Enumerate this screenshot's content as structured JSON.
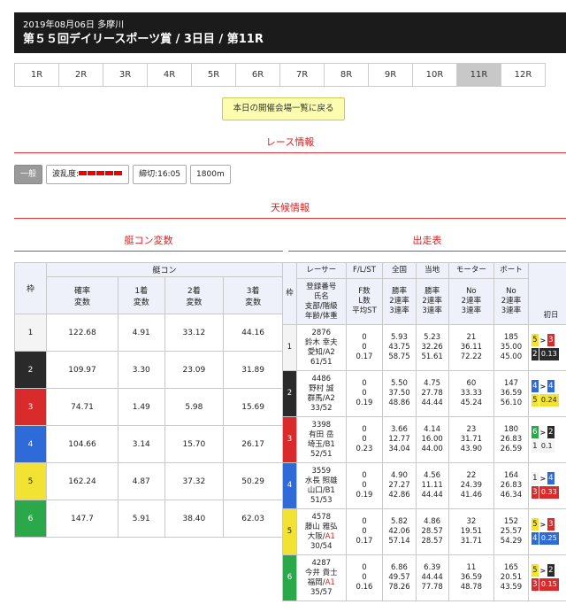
{
  "header": {
    "date": "2019年08月06日 多摩川",
    "title": "第５５回デイリースポーツ賞 / 3日目 / 第11R"
  },
  "race_tabs": [
    "1R",
    "2R",
    "3R",
    "4R",
    "5R",
    "6R",
    "7R",
    "8R",
    "9R",
    "10R",
    "11R",
    "12R"
  ],
  "active_race": "11R",
  "back_button": "本日の開催会場一覧に戻る",
  "sections": {
    "race_info": "レース情報",
    "weather": "天候情報",
    "kyotei_con": "艇コン変数",
    "entry": "出走表"
  },
  "race_info": {
    "grade": "一般",
    "wave_label": "波乱度:",
    "wave_level": 5,
    "deadline": "締切:16:05",
    "distance": "1800m"
  },
  "kyotei_table": {
    "group_header": "艇コン",
    "waku_header": "枠",
    "columns": [
      "確率\n変数",
      "1着\n変数",
      "2着\n変数",
      "3着\n変数"
    ],
    "rows": [
      {
        "waku": "1",
        "vals": [
          "122.68",
          "4.91",
          "33.12",
          "44.16"
        ]
      },
      {
        "waku": "2",
        "vals": [
          "109.97",
          "3.30",
          "23.09",
          "31.89"
        ]
      },
      {
        "waku": "3",
        "vals": [
          "74.71",
          "1.49",
          "5.98",
          "15.69"
        ]
      },
      {
        "waku": "4",
        "vals": [
          "104.66",
          "3.14",
          "15.70",
          "26.17"
        ]
      },
      {
        "waku": "5",
        "vals": [
          "162.24",
          "4.87",
          "37.32",
          "50.29"
        ]
      },
      {
        "waku": "6",
        "vals": [
          "147.7",
          "5.91",
          "38.40",
          "62.03"
        ]
      }
    ]
  },
  "entry_table": {
    "waku_header": "枠",
    "group_headers": [
      "レーサー",
      "F/L/ST",
      "全国",
      "当地",
      "モーター",
      "ボート"
    ],
    "sub_headers": [
      "登録番号\n氏名\n支部/階級\n年齢/体重",
      "F数\nL数\n平均ST",
      "勝率\n2連率\n3連率",
      "勝率\n2連率\n3連率",
      "No\n2連率\n3連率",
      "No\n2連率\n3連率"
    ],
    "recent_header": "初日",
    "rows": [
      {
        "waku": "1",
        "reg": "2876",
        "name": "鈴木 幸夫",
        "branch": "愛知/",
        "rank": "A2",
        "age": "61/51",
        "fl": [
          "0",
          "0",
          "0.17"
        ],
        "zenkoku": [
          "5.93",
          "43.75",
          "58.75"
        ],
        "touchi": [
          "5.23",
          "32.26",
          "51.61"
        ],
        "motor": [
          "21",
          "36.11",
          "72.22"
        ],
        "boat": [
          "185",
          "35.00",
          "45.00"
        ],
        "recent": {
          "top": [
            "5",
            "3"
          ],
          "bottom": [
            "2",
            "0.13"
          ]
        }
      },
      {
        "waku": "2",
        "reg": "4486",
        "name": "野村 誠",
        "branch": "群馬/",
        "rank": "A2",
        "age": "33/52",
        "fl": [
          "0",
          "0",
          "0.19"
        ],
        "zenkoku": [
          "5.50",
          "37.50",
          "48.86"
        ],
        "touchi": [
          "4.75",
          "27.78",
          "44.44"
        ],
        "motor": [
          "60",
          "33.33",
          "45.24"
        ],
        "boat": [
          "147",
          "36.59",
          "56.10"
        ],
        "recent": {
          "top": [
            "4",
            "4"
          ],
          "bottom": [
            "5",
            "0.24"
          ]
        }
      },
      {
        "waku": "3",
        "reg": "3398",
        "name": "有田 岳",
        "branch": "埼玉/",
        "rank": "B1",
        "age": "52/51",
        "fl": [
          "0",
          "0",
          "0.23"
        ],
        "zenkoku": [
          "3.66",
          "12.77",
          "34.04"
        ],
        "touchi": [
          "4.14",
          "16.00",
          "44.00"
        ],
        "motor": [
          "23",
          "31.71",
          "43.90"
        ],
        "boat": [
          "180",
          "26.83",
          "26.59"
        ],
        "recent": {
          "top": [
            "6",
            "2"
          ],
          "bottom": [
            "1",
            "0.1"
          ]
        }
      },
      {
        "waku": "4",
        "reg": "3559",
        "name": "水長 照雄",
        "branch": "山口/",
        "rank": "B1",
        "age": "51/53",
        "fl": [
          "0",
          "0",
          "0.19"
        ],
        "zenkoku": [
          "4.90",
          "27.27",
          "42.86"
        ],
        "touchi": [
          "4.56",
          "11.11",
          "44.44"
        ],
        "motor": [
          "22",
          "24.39",
          "41.46"
        ],
        "boat": [
          "164",
          "26.83",
          "46.34"
        ],
        "recent": {
          "top": [
            "1",
            "4"
          ],
          "bottom": [
            "3",
            "0.33"
          ]
        }
      },
      {
        "waku": "5",
        "reg": "4578",
        "name": "藤山 雅弘",
        "branch": "大阪/",
        "rank": "A1",
        "age": "30/54",
        "fl": [
          "0",
          "0",
          "0.17"
        ],
        "zenkoku": [
          "5.82",
          "42.06",
          "57.14"
        ],
        "touchi": [
          "4.86",
          "28.57",
          "28.57"
        ],
        "motor": [
          "32",
          "19.51",
          "31.71"
        ],
        "boat": [
          "152",
          "25.57",
          "54.29"
        ],
        "recent": {
          "top": [
            "5",
            "3"
          ],
          "bottom": [
            "4",
            "0.25"
          ]
        }
      },
      {
        "waku": "6",
        "reg": "4287",
        "name": "今井 貴士",
        "branch": "福岡/",
        "rank": "A1",
        "age": "35/57",
        "fl": [
          "0",
          "0",
          "0.16"
        ],
        "zenkoku": [
          "6.86",
          "49.57",
          "78.26"
        ],
        "touchi": [
          "6.39",
          "44.44",
          "77.78"
        ],
        "motor": [
          "11",
          "36.59",
          "48.78"
        ],
        "boat": [
          "165",
          "20.51",
          "43.59"
        ],
        "recent": {
          "top": [
            "5",
            "2"
          ],
          "bottom": [
            "3",
            "0.15"
          ]
        }
      }
    ]
  },
  "colors": {
    "waku_1": "#f4f4f4",
    "waku_2": "#2a2a2a",
    "waku_3": "#d92b2b",
    "waku_4": "#2f6ad9",
    "waku_5": "#f2e233",
    "waku_6": "#2aa84a",
    "accent": "#dd2222"
  }
}
